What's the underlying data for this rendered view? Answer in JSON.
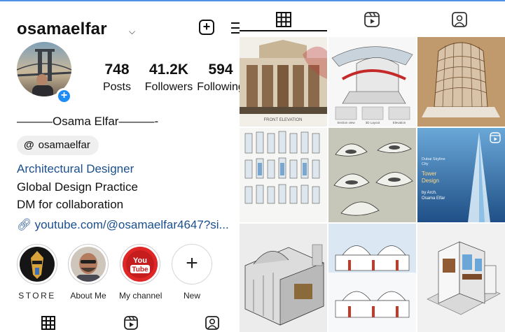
{
  "profile": {
    "username": "osamaelfar",
    "chevron": "⌄",
    "new_post_icon": "plus-square-icon",
    "menu_icon": "hamburger-menu-icon",
    "display_name": "———Osama Elfar———-",
    "threads_handle": "osamaelfar",
    "threads_icon": "threads-icon",
    "bio": {
      "category": "Architectural Designer",
      "line1": "Global Design Practice",
      "line2": "DM for collaboration",
      "link": "youtube.com/@osamaelfar4647?si..."
    }
  },
  "stats": [
    {
      "value": "748",
      "label": "Posts"
    },
    {
      "value": "41.2K",
      "label": "Followers"
    },
    {
      "value": "594",
      "label": "Following"
    }
  ],
  "highlights": [
    {
      "label": "STORE"
    },
    {
      "label": "About Me"
    },
    {
      "label": "My channel",
      "badge_top": "You",
      "badge_bottom": "Tube"
    },
    {
      "label": "New"
    }
  ],
  "tabs": {
    "grid_icon": "grid-icon",
    "reels_icon": "reels-icon",
    "tagged_icon": "tagged-icon"
  },
  "posts": [
    {
      "id": "p1",
      "caption": "FRONT ELEVATION"
    },
    {
      "id": "p2",
      "labels": [
        "Section view",
        "3D Layout",
        "Elevation"
      ]
    },
    {
      "id": "p3"
    },
    {
      "id": "p4"
    },
    {
      "id": "p5"
    },
    {
      "id": "p6",
      "line1": "Dubai Skyline",
      "line2": "City",
      "title1": "Tower",
      "title2": "Design",
      "by": "by Arch.",
      "author": "Osama Elfar"
    },
    {
      "id": "p7"
    },
    {
      "id": "p8"
    },
    {
      "id": "p9"
    }
  ],
  "colors": {
    "link_blue": "#1b4f8c",
    "add_badge": "#1d8cf4",
    "youtube_red": "#d91f1f",
    "top_accent": "#4f8fe6"
  }
}
